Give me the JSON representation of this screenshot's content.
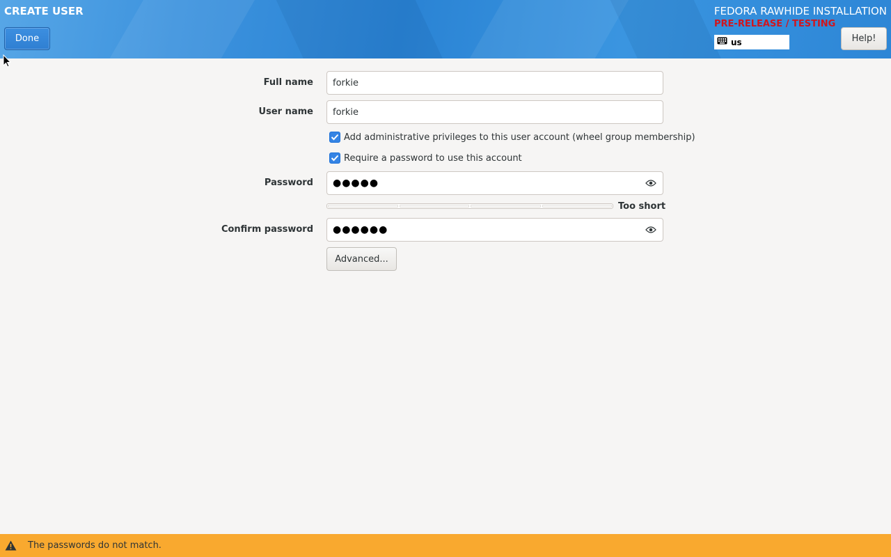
{
  "header": {
    "spoke_title": "CREATE USER",
    "done_label": "Done",
    "product_title": "FEDORA RAWHIDE INSTALLATION",
    "prerelease_text": "PRE-RELEASE / TESTING",
    "keyboard_layout": "us",
    "help_label": "Help!",
    "prerelease_color": "#d0161e"
  },
  "form": {
    "full_name": {
      "label": "Full name",
      "value": "forkie"
    },
    "user_name": {
      "label": "User name",
      "value": "forkie"
    },
    "admin_checkbox": {
      "label": "Add administrative privileges to this user account (wheel group membership)",
      "checked": true
    },
    "require_password_checkbox": {
      "label": "Require a password to use this account",
      "checked": true
    },
    "password": {
      "label": "Password",
      "masked": "●●●●●"
    },
    "strength": {
      "text": "Too short",
      "level": 0
    },
    "confirm_password": {
      "label": "Confirm password",
      "masked": "●●●●●●"
    },
    "advanced_label": "Advanced..."
  },
  "status": {
    "icon": "warning-icon",
    "message": "The passwords do not match.",
    "color": "#f9a92f"
  }
}
